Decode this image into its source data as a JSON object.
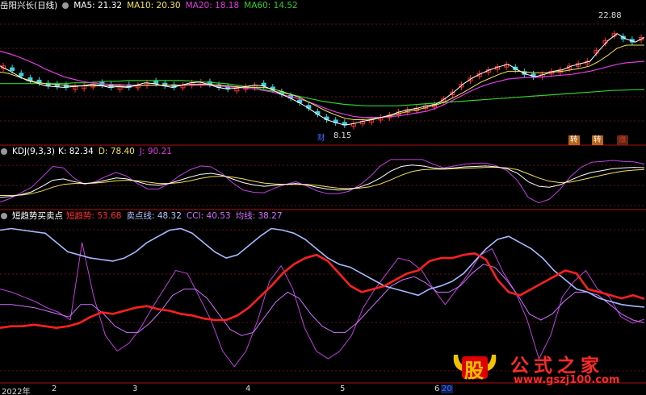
{
  "stock_name": "岳阳兴长(日线)",
  "ma_legend": [
    {
      "label": "MA5: 21.32",
      "color": "#ffffff"
    },
    {
      "label": "MA10: 20.30",
      "color": "#f2e35a"
    },
    {
      "label": "MA20: 18.18",
      "color": "#e33be3"
    },
    {
      "label": "MA60: 14.52",
      "color": "#2fcf2f"
    }
  ],
  "kdj_legend": {
    "title": "KDJ(9,3,3)",
    "items": [
      {
        "label": "K: 82.34",
        "color": "#ffffff"
      },
      {
        "label": "D: 78.40",
        "color": "#f2e35a"
      },
      {
        "label": "J: 90.21",
        "color": "#e33be3"
      }
    ]
  },
  "trend_legend": {
    "title": "短趋势买卖点",
    "items": [
      {
        "label": "短趋势: 53.68",
        "color": "#ff3030"
      },
      {
        "label": "卖点线: 48.32",
        "color": "#b0c4ff"
      },
      {
        "label": "CCI: 40.53",
        "color": "#d070ff"
      },
      {
        "label": "均线: 38.27",
        "color": "#d070ff"
      }
    ]
  },
  "price_labels": {
    "high": "22.88",
    "low": "8.15"
  },
  "event_tags": [
    {
      "text": "财",
      "color": "#3a6cff",
      "bg": "#000000"
    },
    {
      "text": "转",
      "color": "#ffffff",
      "bg": "#b8651a"
    },
    {
      "text": "转",
      "color": "#ffffff",
      "bg": "#b8651a"
    },
    {
      "text": "涨",
      "color": "#ff3030",
      "bg": "#5a2a10"
    }
  ],
  "x_axis_labels": [
    "2022年",
    "2",
    "3",
    "4",
    "5",
    "6",
    "20"
  ],
  "watermark": {
    "glyph": "股",
    "text": "公式之家",
    "url": "www.gszj100.com"
  },
  "chart_data": {
    "type": "line",
    "title": "岳阳兴长(日线)",
    "x_ticks": [
      "2022年",
      "2",
      "3",
      "4",
      "5",
      "6",
      "20"
    ],
    "price": {
      "high": 22.88,
      "low": 8.15,
      "ma5_close_series": [
        17.6,
        17.0,
        16.3,
        15.7,
        15.4,
        15.0,
        14.9,
        14.8,
        14.9,
        15.0,
        15.2,
        15.1,
        14.8,
        14.9,
        14.8,
        15.1,
        15.4,
        15.3,
        15.0,
        14.8,
        15.1,
        15.4,
        15.5,
        15.2,
        14.8,
        14.6,
        14.7,
        14.9,
        15.1,
        15.0,
        14.5,
        13.9,
        13.4,
        12.8,
        12.1,
        11.3,
        10.6,
        10.2,
        9.9,
        10.1,
        10.4,
        10.6,
        10.9,
        11.2,
        11.6,
        11.9,
        12.1,
        12.4,
        12.6,
        13.3,
        14.2,
        15.2,
        16.0,
        16.6,
        17.1,
        17.5,
        17.8,
        17.1,
        16.5,
        16.2,
        16.5,
        16.9,
        17.1,
        17.6,
        17.9,
        18.2,
        19.6,
        20.9,
        21.8,
        21.1,
        20.7,
        21.3
      ],
      "ma10_series": [
        16.8,
        16.6,
        16.2,
        15.8,
        15.5,
        15.3,
        15.2,
        15.1,
        15.0,
        15.0,
        15.0,
        15.0,
        15.0,
        15.0,
        14.9,
        15.0,
        15.1,
        15.1,
        15.1,
        15.1,
        15.1,
        15.2,
        15.2,
        15.2,
        15.1,
        15.0,
        14.9,
        14.8,
        14.8,
        14.8,
        14.6,
        14.3,
        13.9,
        13.5,
        12.9,
        12.3,
        11.7,
        11.2,
        10.8,
        10.6,
        10.6,
        10.7,
        10.9,
        11.1,
        11.4,
        11.7,
        11.9,
        12.2,
        12.5,
        12.9,
        13.5,
        14.1,
        14.8,
        15.5,
        16.0,
        16.5,
        16.9,
        16.9,
        16.8,
        16.7,
        16.7,
        16.8,
        16.9,
        17.1,
        17.3,
        17.6,
        18.2,
        19.0,
        19.9,
        20.3,
        20.3,
        20.3
      ],
      "ma20_series": [
        19.5,
        19.2,
        18.8,
        18.3,
        17.8,
        17.2,
        16.7,
        16.2,
        15.9,
        15.6,
        15.4,
        15.3,
        15.2,
        15.2,
        15.1,
        15.1,
        15.1,
        15.1,
        15.1,
        15.1,
        15.1,
        15.1,
        15.1,
        15.1,
        15.0,
        14.9,
        14.8,
        14.7,
        14.6,
        14.4,
        14.2,
        13.9,
        13.6,
        13.3,
        12.9,
        12.5,
        12.0,
        11.6,
        11.3,
        11.0,
        10.9,
        10.9,
        10.9,
        11.0,
        11.1,
        11.3,
        11.5,
        11.7,
        12.1,
        12.6,
        13.2,
        13.8,
        14.4,
        14.9,
        15.3,
        15.6,
        15.9,
        16.0,
        16.1,
        16.1,
        16.2,
        16.3,
        16.4,
        16.5,
        16.7,
        16.9,
        17.2,
        17.5,
        17.8,
        18.0,
        18.1,
        18.2
      ],
      "ma60_series": [
        15.3,
        15.3,
        15.3,
        15.3,
        15.3,
        15.3,
        15.3,
        15.4,
        15.4,
        15.5,
        15.6,
        15.6,
        15.7,
        15.7,
        15.7,
        15.7,
        15.7,
        15.7,
        15.6,
        15.5,
        15.4,
        15.3,
        15.1,
        14.9,
        14.7,
        14.4,
        14.2,
        13.9,
        13.6,
        13.3,
        13.0,
        12.8,
        12.6,
        12.5,
        12.4,
        12.4,
        12.4,
        12.4,
        12.5,
        12.6,
        12.7,
        12.8,
        12.9,
        13.0,
        13.1,
        13.2,
        13.3,
        13.4,
        13.5,
        13.6,
        13.7,
        13.8,
        13.9,
        14.0,
        14.1,
        14.2,
        14.3,
        14.4,
        14.45,
        14.5,
        14.52
      ]
    },
    "kdj": {
      "K_series": [
        18,
        20,
        24,
        30,
        42,
        55,
        58,
        52,
        48,
        50,
        55,
        60,
        58,
        52,
        46,
        44,
        48,
        55,
        62,
        68,
        70,
        66,
        58,
        50,
        45,
        42,
        44,
        46,
        48,
        45,
        40,
        36,
        34,
        35,
        40,
        48,
        60,
        75,
        85,
        88,
        86,
        82,
        80,
        82,
        84,
        85,
        86,
        84,
        80,
        70,
        52,
        42,
        40,
        45,
        55,
        65,
        72,
        76,
        80,
        82,
        83,
        82.34
      ],
      "D_series": [
        22,
        22,
        23,
        26,
        32,
        40,
        46,
        48,
        48,
        49,
        51,
        54,
        55,
        54,
        51,
        48,
        48,
        50,
        54,
        59,
        63,
        64,
        62,
        58,
        53,
        49,
        47,
        46,
        46,
        46,
        44,
        41,
        38,
        37,
        38,
        41,
        47,
        56,
        66,
        74,
        78,
        79,
        79,
        80,
        81,
        82,
        83,
        83,
        82,
        78,
        69,
        60,
        53,
        50,
        51,
        56,
        61,
        66,
        71,
        75,
        77,
        78.4
      ],
      "J_series": [
        8,
        16,
        28,
        40,
        62,
        85,
        82,
        60,
        46,
        52,
        63,
        72,
        64,
        48,
        36,
        36,
        48,
        65,
        78,
        86,
        84,
        70,
        50,
        34,
        29,
        28,
        38,
        46,
        52,
        43,
        32,
        26,
        26,
        31,
        44,
        62,
        86,
        100,
        100,
        100,
        100,
        90,
        82,
        86,
        90,
        92,
        92,
        86,
        76,
        54,
        18,
        6,
        14,
        35,
        63,
        83,
        94,
        96,
        98,
        96,
        95,
        90.21
      ]
    },
    "short_trend": {
      "短趋势_series": [
        35,
        36,
        36,
        37,
        36,
        35,
        36,
        38,
        42,
        45,
        44,
        46,
        48,
        49,
        47,
        46,
        44,
        43,
        41,
        40,
        40,
        43,
        48,
        55,
        62,
        70,
        76,
        80,
        82,
        78,
        70,
        62,
        58,
        60,
        62,
        66,
        70,
        72,
        78,
        80,
        80,
        82,
        83,
        79,
        66,
        58,
        56,
        60,
        64,
        68,
        72,
        70,
        60,
        58,
        56,
        54,
        56,
        53.68
      ],
      "卖点线_series": [
        98,
        99,
        98,
        97,
        96,
        90,
        84,
        82,
        80,
        79,
        78,
        80,
        84,
        90,
        94,
        98,
        99,
        96,
        90,
        84,
        80,
        82,
        88,
        94,
        99,
        98,
        96,
        92,
        86,
        80,
        76,
        74,
        70,
        66,
        62,
        60,
        58,
        56,
        60,
        62,
        65,
        70,
        78,
        86,
        92,
        94,
        90,
        86,
        80,
        72,
        66,
        60,
        58,
        54,
        52,
        50,
        49,
        48.32
      ],
      "CCI_series": [
        60,
        58,
        55,
        52,
        48,
        45,
        40,
        90,
        55,
        30,
        20,
        25,
        35,
        48,
        60,
        72,
        70,
        55,
        40,
        20,
        10,
        20,
        40,
        65,
        75,
        60,
        35,
        20,
        15,
        20,
        30,
        48,
        60,
        70,
        80,
        78,
        72,
        60,
        50,
        60,
        70,
        82,
        86,
        70,
        58,
        40,
        15,
        30,
        55,
        65,
        72,
        60,
        55,
        42,
        38,
        40.53
      ],
      "均线_series": [
        50,
        50,
        49,
        48,
        46,
        44,
        42,
        50,
        50,
        44,
        36,
        32,
        32,
        38,
        46,
        56,
        60,
        60,
        54,
        44,
        34,
        30,
        32,
        42,
        52,
        58,
        54,
        44,
        36,
        32,
        32,
        38,
        46,
        54,
        62,
        66,
        68,
        64,
        58,
        58,
        62,
        70,
        76,
        74,
        66,
        56,
        44,
        40,
        44,
        52,
        58,
        58,
        56,
        50,
        44,
        40,
        38.27
      ]
    }
  }
}
